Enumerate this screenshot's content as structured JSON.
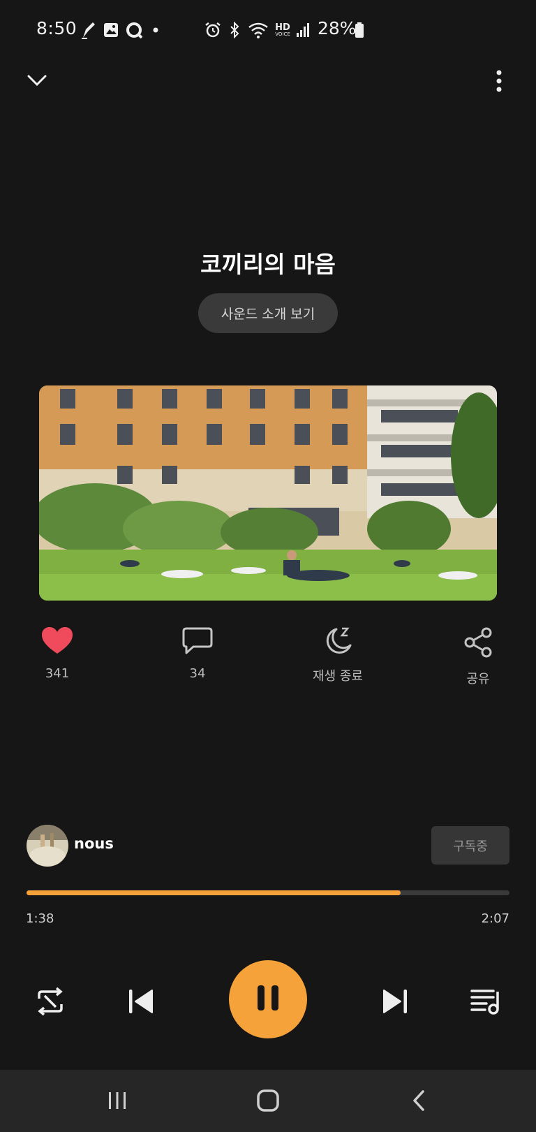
{
  "status_bar": {
    "time": "8:50",
    "battery": "28%",
    "icons": [
      "pen-icon",
      "gallery-icon",
      "sync-icon",
      "dot-icon",
      "alarm-icon",
      "bluetooth-icon",
      "wifi-icon",
      "hd-voice-icon",
      "signal-icon",
      "battery-icon"
    ]
  },
  "header": {
    "collapse_icon": "chevron-down-icon",
    "menu_icon": "more-vertical-icon"
  },
  "track": {
    "title": "코끼리의 마음",
    "intro_button": "사운드 소개 보기"
  },
  "actions": {
    "like_count": "341",
    "comment_count": "34",
    "sleep_label": "재생 종료",
    "share_label": "공유"
  },
  "creator": {
    "name": "nous",
    "subscribe_label": "구독중"
  },
  "player": {
    "progress": 0.775,
    "elapsed": "1:38",
    "duration": "2:07"
  },
  "colors": {
    "accent": "#f6a23a",
    "like": "#ef4b5c",
    "background": "#161616"
  }
}
